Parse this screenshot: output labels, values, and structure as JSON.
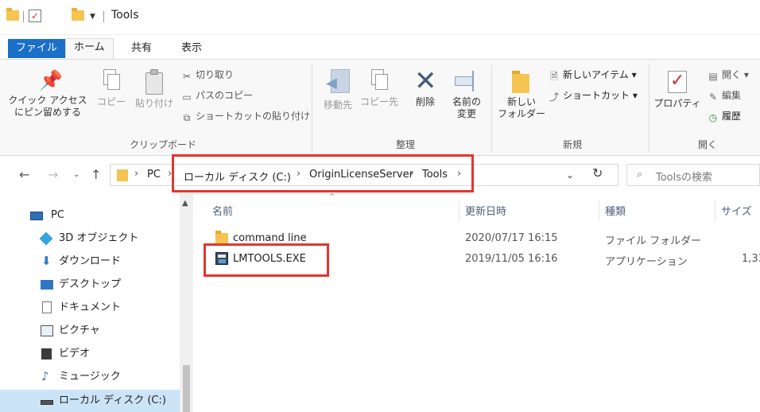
{
  "window": {
    "title": "Tools"
  },
  "ribbon_tabs": [
    "ファイル",
    "ホーム",
    "共有",
    "表示"
  ],
  "ribbon": {
    "clipboard": {
      "pin_label_1": "クイック アクセス",
      "pin_label_2": "にピン留めする",
      "copy": "コピー",
      "paste": "貼り付け",
      "cut": "切り取り",
      "copy_path": "パスのコピー",
      "paste_shortcut": "ショートカットの貼り付け",
      "group": "クリップボード"
    },
    "organize": {
      "move_to": "移動先",
      "copy_to": "コピー先",
      "delete": "削除",
      "rename_1": "名前の",
      "rename_2": "変更",
      "group": "整理"
    },
    "new": {
      "new_folder_1": "新しい",
      "new_folder_2": "フォルダー",
      "new_item": "新しいアイテム ▾",
      "shortcut": "ショートカット ▾",
      "group": "新規"
    },
    "open": {
      "properties": "プロパティ",
      "open": "開く ▾",
      "edit": "編集",
      "history": "履歴",
      "group": "開く"
    }
  },
  "address": {
    "crumbs": [
      "PC",
      "ローカル ディスク (C:)",
      "OriginLicenseServer",
      "Tools"
    ],
    "search_placeholder": "Toolsの検索"
  },
  "nav_pane": [
    {
      "label": "PC",
      "icon": "pc-icon"
    },
    {
      "label": "3D オブジェクト",
      "icon": "3d-objects-icon"
    },
    {
      "label": "ダウンロード",
      "icon": "download-icon"
    },
    {
      "label": "デスクトップ",
      "icon": "desktop-icon"
    },
    {
      "label": "ドキュメント",
      "icon": "documents-icon"
    },
    {
      "label": "ピクチャ",
      "icon": "pictures-icon"
    },
    {
      "label": "ビデオ",
      "icon": "videos-icon"
    },
    {
      "label": "ミュージック",
      "icon": "music-icon"
    },
    {
      "label": "ローカル ディスク (C:)",
      "icon": "local-disk-icon"
    }
  ],
  "columns": {
    "name": "名前",
    "modified": "更新日時",
    "type": "種類",
    "size": "サイズ"
  },
  "files": [
    {
      "name": "command line",
      "modified": "2020/07/17 16:15",
      "type": "ファイル フォルダー",
      "size": ""
    },
    {
      "name": "LMTOOLS.EXE",
      "modified": "2019/11/05 16:16",
      "type": "アプリケーション",
      "size": "1,33"
    }
  ],
  "colors": {
    "accent": "#1a6fc9",
    "highlight": "#e5352f",
    "selection": "#cce4f7"
  }
}
